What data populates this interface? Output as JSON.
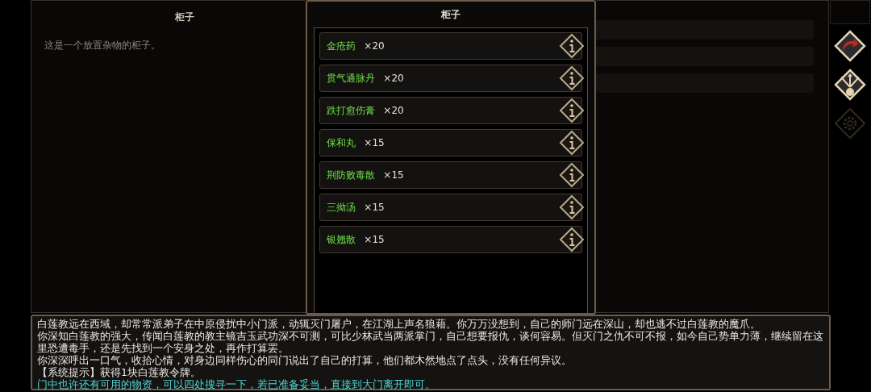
{
  "info_panel": {
    "title": "柜子",
    "description": "这是一个放置杂物的柜子。"
  },
  "container_dialog": {
    "title": "柜子",
    "items": [
      {
        "name": "金疮药",
        "count": "×20"
      },
      {
        "name": "贯气通脉丹",
        "count": "×20"
      },
      {
        "name": "跌打愈伤膏",
        "count": "×20"
      },
      {
        "name": "保和丸",
        "count": "×15"
      },
      {
        "name": "荆防败毒散",
        "count": "×15"
      },
      {
        "name": "三拗汤",
        "count": "×15"
      },
      {
        "name": "银翘散",
        "count": "×15"
      }
    ]
  },
  "side_actions": [
    {
      "kind": "return",
      "disabled": false
    },
    {
      "kind": "loot",
      "disabled": false
    },
    {
      "kind": "settings",
      "disabled": true
    }
  ],
  "message_log": [
    {
      "kind": "narrative",
      "text": "白莲教远在西域，却常常派弟子在中原侵扰中小门派，动辄灭门屠户，在江湖上声名狼藉。你万万没想到，自己的师门远在深山，却也逃不过白莲教的魔爪。"
    },
    {
      "kind": "narrative",
      "text": "你深知白莲教的强大，传闻白莲教的教主镜吉玉武功深不可测，可比少林武当两派掌门，自己想要报仇，谈何容易。但灭门之仇不可不报，如今自己势单力薄，继续留在这里恐遭毒手，还是先找到一个安身之处，再作打算罢。"
    },
    {
      "kind": "narrative",
      "text": "你深深呼出一口气，收拾心情，对身边同样伤心的同门说出了自己的打算，他们都木然地点了点头，没有任何异议。"
    },
    {
      "kind": "system",
      "text": "【系统提示】获得1块白莲教令牌。"
    },
    {
      "kind": "hint",
      "text": "门中也许还有可用的物资，可以四处搜寻一下，若已准备妥当，直接到大门离开即可。"
    }
  ]
}
